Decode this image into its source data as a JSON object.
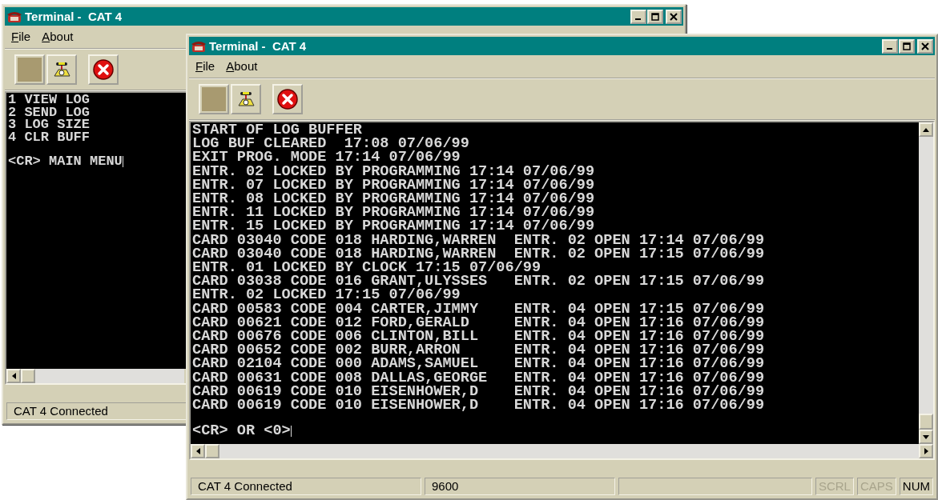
{
  "windows": [
    {
      "title": "Terminal -  CAT 4",
      "menu": [
        {
          "label": "File"
        },
        {
          "label": "About"
        }
      ],
      "terminal": {
        "paragraphs": [
          [
            "1 VIEW LOG",
            "2 SEND LOG",
            "3 LOG SIZE",
            "4 CLR BUFF"
          ],
          [
            "<CR> MAIN MENU"
          ]
        ]
      },
      "status_bar": [
        {
          "kind": "text",
          "text": "CAT 4 Connected"
        }
      ]
    },
    {
      "title": "Terminal -  CAT 4",
      "menu": [
        {
          "label": "File"
        },
        {
          "label": "About"
        }
      ],
      "terminal": {
        "paragraphs": [
          [
            "START OF LOG BUFFER",
            "LOG BUF CLEARED  17:08 07/06/99",
            "EXIT PROG. MODE 17:14 07/06/99",
            "ENTR. 02 LOCKED BY PROGRAMMING 17:14 07/06/99",
            "ENTR. 07 LOCKED BY PROGRAMMING 17:14 07/06/99",
            "ENTR. 08 LOCKED BY PROGRAMMING 17:14 07/06/99",
            "ENTR. 11 LOCKED BY PROGRAMMING 17:14 07/06/99",
            "ENTR. 15 LOCKED BY PROGRAMMING 17:14 07/06/99",
            "CARD 03040 CODE 018 HARDING,WARREN  ENTR. 02 OPEN 17:14 07/06/99",
            "CARD 03040 CODE 018 HARDING,WARREN  ENTR. 02 OPEN 17:15 07/06/99",
            "ENTR. 01 LOCKED BY CLOCK 17:15 07/06/99",
            "CARD 03038 CODE 016 GRANT,ULYSSES   ENTR. 02 OPEN 17:15 07/06/99",
            "ENTR. 02 LOCKED 17:15 07/06/99",
            "CARD 00583 CODE 004 CARTER,JIMMY    ENTR. 04 OPEN 17:15 07/06/99",
            "CARD 00621 CODE 012 FORD,GERALD     ENTR. 04 OPEN 17:16 07/06/99",
            "CARD 00676 CODE 006 CLINTON,BILL    ENTR. 04 OPEN 17:16 07/06/99",
            "CARD 00652 CODE 002 BURR,ARRON      ENTR. 04 OPEN 17:16 07/06/99",
            "CARD 02104 CODE 000 ADAMS,SAMUEL    ENTR. 04 OPEN 17:16 07/06/99",
            "CARD 00631 CODE 008 DALLAS,GEORGE   ENTR. 04 OPEN 17:16 07/06/99",
            "CARD 00619 CODE 010 EISENHOWER,D    ENTR. 04 OPEN 17:16 07/06/99",
            "CARD 00619 CODE 010 EISENHOWER,D    ENTR. 04 OPEN 17:16 07/06/99"
          ],
          [
            "<CR> OR <0>"
          ]
        ]
      },
      "status_bar": [
        {
          "kind": "text",
          "text": "CAT 4 Connected"
        },
        {
          "kind": "text",
          "text": "9600"
        },
        {
          "kind": "blank"
        },
        {
          "kind": "indicator",
          "text": "SCRL",
          "on": false
        },
        {
          "kind": "indicator",
          "text": "CAPS",
          "on": false
        },
        {
          "kind": "indicator",
          "text": "NUM",
          "on": true
        }
      ]
    }
  ]
}
